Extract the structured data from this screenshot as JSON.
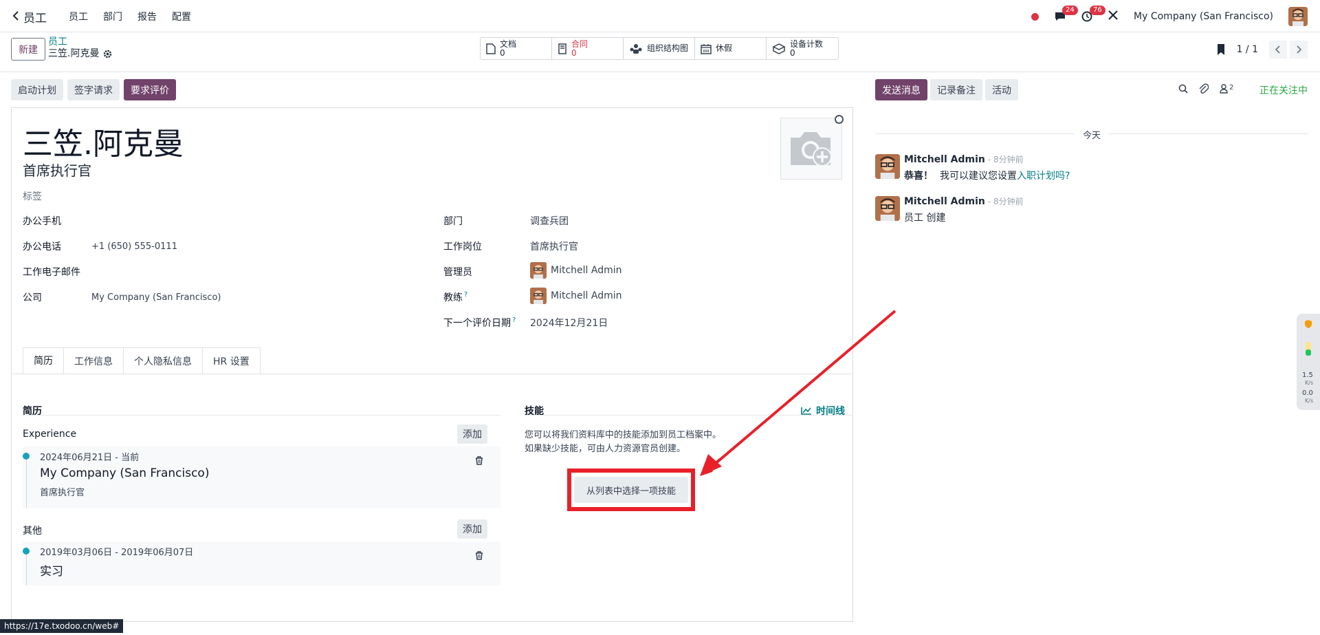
{
  "topnav": {
    "app": "员工",
    "menu": [
      "员工",
      "部门",
      "报告",
      "配置"
    ],
    "messages_count": "24",
    "activities_count": "76",
    "company": "My Company (San Francisco)"
  },
  "control_panel": {
    "new_label": "新建",
    "breadcrumb_parent": "员工",
    "breadcrumb_current": "三笠.阿克曼",
    "smart_buttons": [
      {
        "label": "文档",
        "value": "0",
        "icon": "document-icon"
      },
      {
        "label": "合同",
        "value": "0",
        "icon": "contract-icon"
      },
      {
        "label": "组织结构图",
        "value": "",
        "icon": "org-chart-icon"
      },
      {
        "label": "休假",
        "value": "",
        "icon": "calendar-icon"
      },
      {
        "label": "设备计数",
        "value": "0",
        "icon": "equipment-icon"
      }
    ],
    "pager": "1 / 1"
  },
  "actions": {
    "onboarding": "启动计划",
    "signature": "签字请求",
    "appraisal": "要求评价"
  },
  "employee": {
    "name": "三笠.阿克曼",
    "job_title": "首席执行官",
    "tags_placeholder": "标签"
  },
  "fields_left": [
    {
      "label": "办公手机",
      "value": ""
    },
    {
      "label": "办公电话",
      "value": "+1 (650) 555-0111"
    },
    {
      "label": "工作电子邮件",
      "value": ""
    },
    {
      "label": "公司",
      "value": "My Company (San Francisco)"
    }
  ],
  "fields_right": [
    {
      "label": "部门",
      "value": "调查兵团"
    },
    {
      "label": "工作岗位",
      "value": "首席执行官"
    },
    {
      "label": "管理员",
      "value": "Mitchell Admin"
    },
    {
      "label": "教练",
      "value": "Mitchell Admin"
    },
    {
      "label": "下一个评价日期",
      "value": "2024年12月21日"
    }
  ],
  "help_mark": "?",
  "tabs": [
    "简历",
    "工作信息",
    "个人隐私信息",
    "HR 设置"
  ],
  "resume": {
    "title": "简历",
    "add_label": "添加",
    "experience_title": "Experience",
    "experience_date": "2024年06月21日 - 当前",
    "experience_name": "My Company (San Francisco)",
    "experience_desc": "首席执行官",
    "other_title": "其他",
    "other_date": "2019年03月06日 - 2019年06月07日",
    "other_name": "实习"
  },
  "skills": {
    "title": "技能",
    "timeline": "时间线",
    "line1": "您可以将我们资料库中的技能添加到员工档案中。",
    "line2": "如果缺少技能，可由人力资源官员创建。",
    "pick_label": "从列表中选择一项技能"
  },
  "chatter": {
    "send": "发送消息",
    "note": "记录备注",
    "activity": "活动",
    "followers": "2",
    "following": "正在关注中",
    "today": "今天",
    "msg1_author": "Mitchell Admin",
    "msg1_ago": "- 8分钟前",
    "msg1_bold": "恭喜！",
    "msg1_text": "我可以建议您设置",
    "msg1_link": "入职计划吗?",
    "msg2_author": "Mitchell Admin",
    "msg2_ago": "- 8分钟前",
    "msg2_text": "员工 创建"
  },
  "widget": {
    "v1": "1.5",
    "u1": "K/s",
    "v2": "0.0",
    "u2": "K/s"
  },
  "status_url": "https://17e.txodoo.cn/web#",
  "colors": {
    "brand": "#71426a",
    "link": "#017e84",
    "highlight": "#e8202a"
  }
}
